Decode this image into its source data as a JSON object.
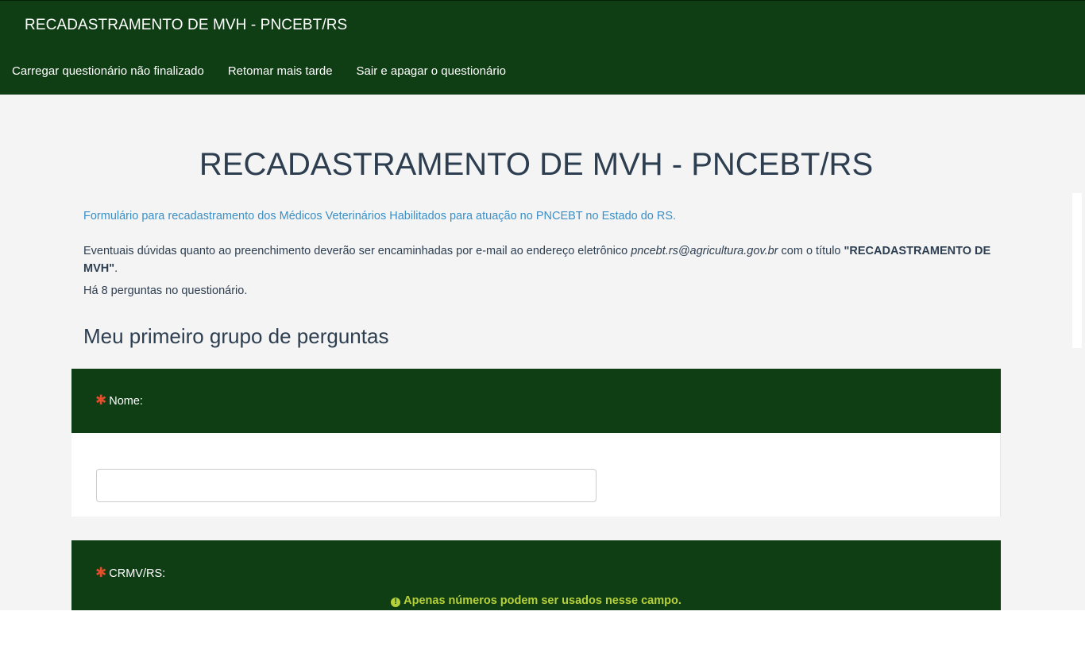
{
  "header": {
    "brand": "RECADASTRAMENTO DE MVH - PNCEBT/RS",
    "nav": [
      "Carregar questionário não finalizado",
      "Retomar mais tarde",
      "Sair e apagar o questionário"
    ]
  },
  "survey": {
    "title": "RECADASTRAMENTO DE MVH - PNCEBT/RS",
    "description": "Formulário para recadastramento dos Médicos Veterinários Habilitados para atuação no PNCEBT no Estado do RS.",
    "note_prefix": "Eventuais dúvidas quanto ao preenchimento deverão ser encaminhadas por e-mail ao endereço eletrônico ",
    "note_email": "pncebt.rs@agricultura.gov.br",
    "note_middle": " com o título ",
    "note_title": "\"RECADASTRAMENTO DE MVH\"",
    "note_suffix": ".",
    "question_count": "Há 8 perguntas no questionário."
  },
  "group": {
    "title": "Meu primeiro grupo de perguntas"
  },
  "questions": [
    {
      "label": "Nome:",
      "required_mark": "✱",
      "value": ""
    },
    {
      "label": "CRMV/RS:",
      "required_mark": "✱",
      "tip": "Apenas números podem ser usados nesse campo.",
      "tip_icon": "!"
    }
  ],
  "colors": {
    "header_bg": "#0f3d14",
    "page_bg": "#f4f4f4",
    "link": "#3a8fc7",
    "required": "#e24e2c",
    "tip": "#b6d13a"
  }
}
